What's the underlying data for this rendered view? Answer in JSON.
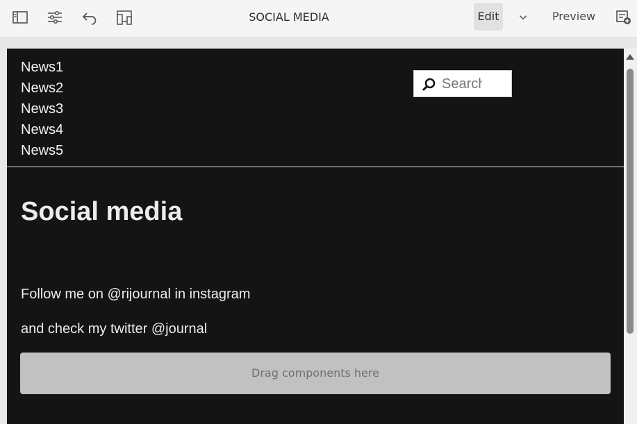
{
  "toolbar": {
    "title": "SOCIAL MEDIA",
    "edit_label": "Edit",
    "preview_label": "Preview",
    "icons": [
      "side-panel-icon",
      "page-properties-icon",
      "undo-icon",
      "emulator-icon",
      "chevron-down-icon",
      "page-information-icon"
    ]
  },
  "page": {
    "nav": [
      "News1",
      "News2",
      "News3",
      "News4",
      "News5"
    ],
    "search": {
      "placeholder": "Search"
    },
    "heading": "Social media",
    "paragraphs": [
      "Follow me on @rijournal in instagram",
      "and check my twitter @journal"
    ],
    "dropzone_label": "Drag components here"
  },
  "colors": {
    "page_background": "#141414",
    "toolbar_background": "#f5f5f5",
    "dropzone": "#c1c1c1",
    "text_light": "#ececec"
  }
}
